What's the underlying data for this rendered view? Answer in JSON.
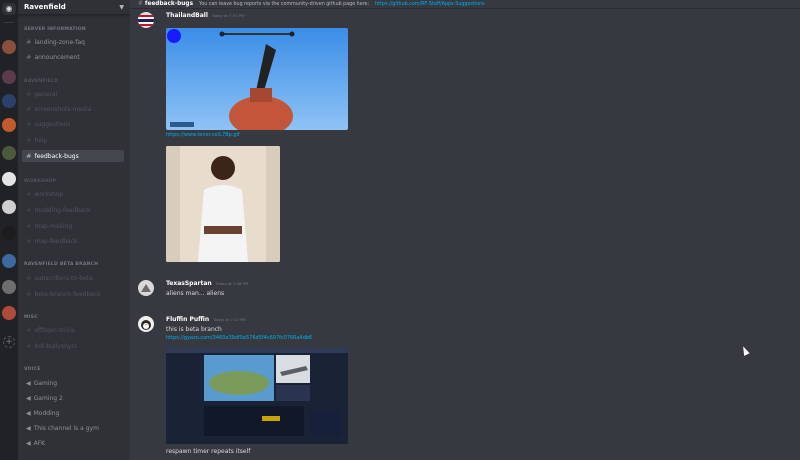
{
  "server": {
    "name": "Ravenfield"
  },
  "categories": {
    "server_information": "SERVER INFORMATION",
    "ravenfield": "Ravenfield",
    "workshop": "Workshop",
    "beta": "RAVENFIELD BETA BRANCH",
    "misc": "MISC",
    "voice": "VOICE"
  },
  "channels": {
    "landing_zone": "landing-zone-faq",
    "announcement": "announcement",
    "general": "general",
    "screenshots": "screenshots-media",
    "suggestions": "suggestions",
    "help": "help",
    "feedback_bugs": "feedback-bugs",
    "workshop": "workshop",
    "modding_feedback": "modding-feedback",
    "map_making": "map-making",
    "map_feedback": "map-feedback",
    "subscribers": "subscribers-to-beta",
    "beta_feedback": "beta-branch-feedback",
    "offtopic": "offtopic-trivia",
    "bot": "bot-bullyshyrs"
  },
  "voice_channels": [
    "Gaming",
    "Gaming 2",
    "Modding",
    "This channel is a gym",
    "AFK"
  ],
  "header": {
    "channel": "feedback-bugs",
    "topic": "You can leave bug reports via the community-driven github page here:",
    "topic_link": "https://github.com/RF-Staff/Apps-Suggestions"
  },
  "messages": [
    {
      "author": "ThailandBall",
      "timestamp": "Today at 7:01 PM",
      "link": "https://www.tenor.co/L7Bp.gif"
    },
    {
      "author": "TexasSpartan",
      "timestamp": "Today at 7:08 PM",
      "text": "aliens man... aliens"
    },
    {
      "author": "Fluffin Puffin",
      "timestamp": "Today at 7:12 PM",
      "text": "this is beta branch",
      "link": "https://gyazo.com/3460a39df0a576d5f4c697fc0766a4db6",
      "text2": "respawn timer repeats itself"
    }
  ],
  "colors": {
    "background": "#36393f",
    "sidebar": "#2f3136",
    "rail": "#202225",
    "link": "#00b0f4"
  }
}
